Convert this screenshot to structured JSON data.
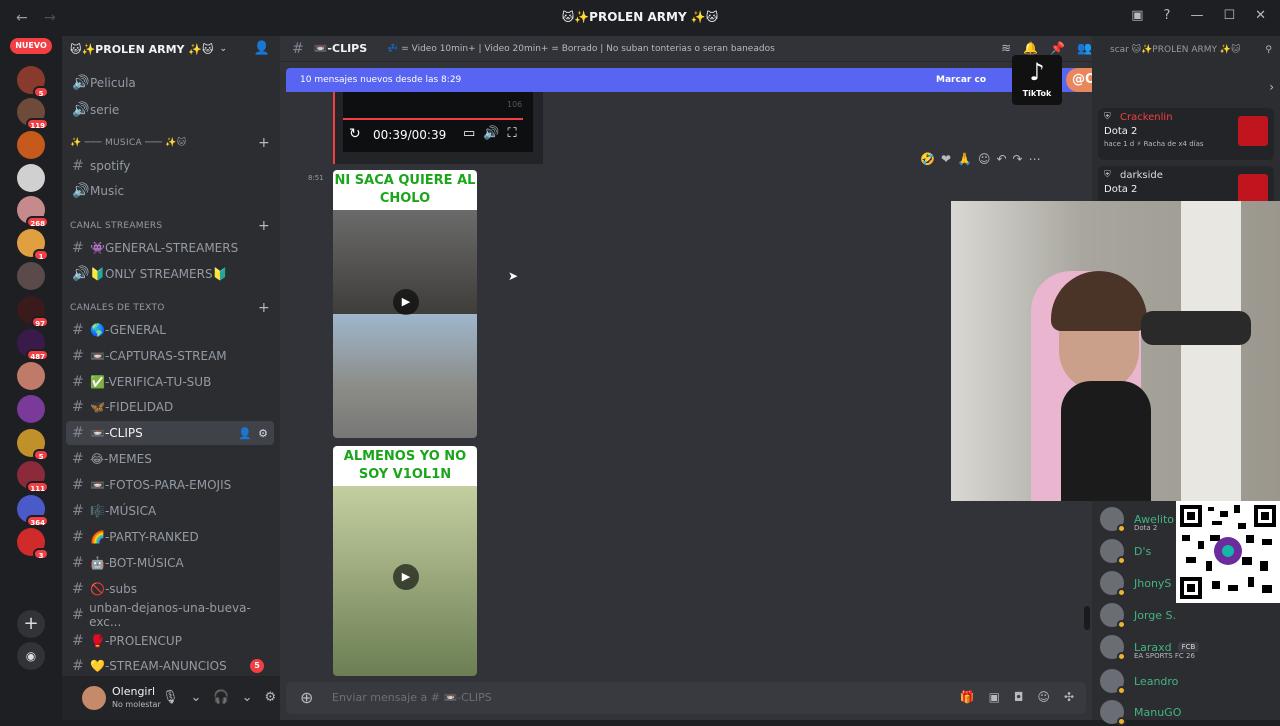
{
  "titlebar": {
    "title": "🐱✨PROLEN ARMY ✨🐱",
    "back": "←",
    "forward": "→",
    "icons": [
      "▣",
      "?",
      "—",
      "☐",
      "✕"
    ]
  },
  "servers": {
    "nuevo": "NUEVO",
    "items": [
      {
        "badge": "5",
        "color": "#8a3a2c"
      },
      {
        "badge": "119",
        "color": "#6e4a3a"
      },
      {
        "badge": "",
        "color": "#c65a1c"
      },
      {
        "badge": "",
        "color": "#d0d0d0"
      },
      {
        "badge": "268",
        "color": "#c78a8c"
      },
      {
        "badge": "1",
        "color": "#e0a040"
      },
      {
        "badge": "",
        "color": "#5a4a4a"
      },
      {
        "badge": "97",
        "color": "#3a1a1a"
      },
      {
        "badge": "487",
        "color": "#3a1a4a"
      },
      {
        "badge": "",
        "color": "#c07a6a"
      },
      {
        "badge": "",
        "color": "#7a3a9a"
      },
      {
        "badge": "5",
        "color": "#c0902a"
      },
      {
        "badge": "111",
        "color": "#8a2a3a"
      },
      {
        "badge": "364",
        "color": "#4a5ac8"
      },
      {
        "badge": "3",
        "color": "#d02a2a"
      }
    ],
    "add": "+",
    "discover": "◉"
  },
  "sidebar": {
    "server_name": "🐱✨PROLEN ARMY ✨🐱",
    "channels_top": [
      {
        "icon": "🔊",
        "label": "Pelicula"
      },
      {
        "icon": "🔊",
        "label": "serie"
      }
    ],
    "cat_musica": "✨ ─── MUSICA ─── ✨🐱",
    "channels_music": [
      {
        "icon": "#",
        "label": "spotify"
      },
      {
        "icon": "🔊",
        "label": "Music"
      }
    ],
    "cat_streamers": "CANAL STREAMERS",
    "channels_streamers": [
      {
        "icon": "#",
        "label": "👾GENERAL-STREAMERS"
      },
      {
        "icon": "🔊",
        "label": "🔰ONLY STREAMERS🔰"
      }
    ],
    "cat_texto": "CANALES DE TEXTO",
    "channels_texto": [
      {
        "icon": "#",
        "label": "🌎-GENERAL"
      },
      {
        "icon": "#",
        "label": "📼-CAPTURAS-STREAM"
      },
      {
        "icon": "#",
        "label": "✅-VERIFICA-TU-SUB"
      },
      {
        "icon": "#",
        "label": "🦋-FIDELIDAD"
      },
      {
        "icon": "#",
        "label": "📼-CLIPS"
      },
      {
        "icon": "#",
        "label": "😂-MEMES"
      },
      {
        "icon": "#",
        "label": "📼-FOTOS-PARA-EMOJIS"
      },
      {
        "icon": "#",
        "label": "🎼-MÚSICA"
      },
      {
        "icon": "#",
        "label": "🌈-PARTY-RANKED"
      },
      {
        "icon": "#",
        "label": "🤖-BOT-MÚSICA"
      },
      {
        "icon": "#",
        "label": "🚫-subs"
      },
      {
        "icon": "#",
        "label": "unban-dejanos-una-bueva-exc..."
      },
      {
        "icon": "#",
        "label": "🥊-PROLENCUP"
      },
      {
        "icon": "#",
        "label": "💛-STREAM-ANUNCIOS"
      }
    ],
    "stream_anuncios_badge": "5"
  },
  "user": {
    "name": "Olengirl",
    "status": "No molestar"
  },
  "channel": {
    "name": "📼-CLIPS",
    "topic": "💤 = Video 10min+ | Video 20min+ = Borrado | No suban tonterias o seran baneados"
  },
  "newbar": {
    "text": "10 mensajes nuevos desde las 8:29",
    "mark": "Marcar co"
  },
  "tiktok": {
    "label": "TikTok",
    "handle": "@OLENGIRL"
  },
  "video": {
    "time": "00:39/00:39",
    "num": "106"
  },
  "message": {
    "time": "8:51"
  },
  "clips": [
    {
      "caption": "NI SACA QUIERE AL CHOLO"
    },
    {
      "caption": "ALMENOS YO NO SOY V1OL1N"
    }
  ],
  "input": {
    "placeholder": "Enviar mensaje a # 📼-CLIPS"
  },
  "right": {
    "search": "scar 🐱✨PROLEN ARMY ✨🐱",
    "activities": [
      {
        "name": "Crackenlin",
        "game": "Dota 2",
        "sub": "hace 1 d  ⚡ Racha de x4 días",
        "color": "#f23f43"
      },
      {
        "name": "darkside",
        "game": "Dota 2",
        "sub": "",
        "color": "#dbdee1"
      }
    ],
    "members": [
      {
        "name": "Awelito",
        "sub": "Dota 2",
        "tag": ""
      },
      {
        "name": "D's",
        "sub": "",
        "tag": ""
      },
      {
        "name": "JhonyS",
        "sub": "",
        "tag": ""
      },
      {
        "name": "Jorge S.",
        "sub": "",
        "tag": ""
      },
      {
        "name": "Laraxd",
        "sub": "EA SPORTS FC 26",
        "tag": "FCB"
      },
      {
        "name": "Leandro",
        "sub": "",
        "tag": ""
      },
      {
        "name": "ManuGO",
        "sub": "",
        "tag": ""
      }
    ]
  }
}
